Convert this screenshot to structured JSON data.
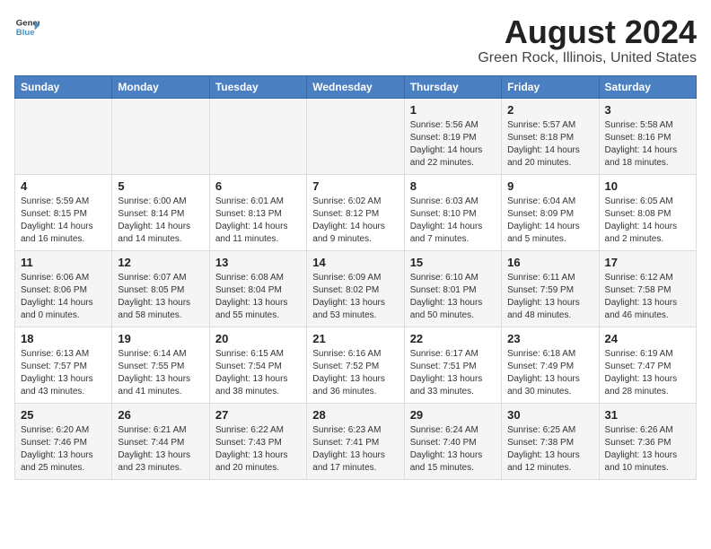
{
  "header": {
    "logo_line1": "General",
    "logo_line2": "Blue",
    "title": "August 2024",
    "subtitle": "Green Rock, Illinois, United States"
  },
  "weekdays": [
    "Sunday",
    "Monday",
    "Tuesday",
    "Wednesday",
    "Thursday",
    "Friday",
    "Saturday"
  ],
  "weeks": [
    [
      {
        "day": "",
        "info": ""
      },
      {
        "day": "",
        "info": ""
      },
      {
        "day": "",
        "info": ""
      },
      {
        "day": "",
        "info": ""
      },
      {
        "day": "1",
        "info": "Sunrise: 5:56 AM\nSunset: 8:19 PM\nDaylight: 14 hours\nand 22 minutes."
      },
      {
        "day": "2",
        "info": "Sunrise: 5:57 AM\nSunset: 8:18 PM\nDaylight: 14 hours\nand 20 minutes."
      },
      {
        "day": "3",
        "info": "Sunrise: 5:58 AM\nSunset: 8:16 PM\nDaylight: 14 hours\nand 18 minutes."
      }
    ],
    [
      {
        "day": "4",
        "info": "Sunrise: 5:59 AM\nSunset: 8:15 PM\nDaylight: 14 hours\nand 16 minutes."
      },
      {
        "day": "5",
        "info": "Sunrise: 6:00 AM\nSunset: 8:14 PM\nDaylight: 14 hours\nand 14 minutes."
      },
      {
        "day": "6",
        "info": "Sunrise: 6:01 AM\nSunset: 8:13 PM\nDaylight: 14 hours\nand 11 minutes."
      },
      {
        "day": "7",
        "info": "Sunrise: 6:02 AM\nSunset: 8:12 PM\nDaylight: 14 hours\nand 9 minutes."
      },
      {
        "day": "8",
        "info": "Sunrise: 6:03 AM\nSunset: 8:10 PM\nDaylight: 14 hours\nand 7 minutes."
      },
      {
        "day": "9",
        "info": "Sunrise: 6:04 AM\nSunset: 8:09 PM\nDaylight: 14 hours\nand 5 minutes."
      },
      {
        "day": "10",
        "info": "Sunrise: 6:05 AM\nSunset: 8:08 PM\nDaylight: 14 hours\nand 2 minutes."
      }
    ],
    [
      {
        "day": "11",
        "info": "Sunrise: 6:06 AM\nSunset: 8:06 PM\nDaylight: 14 hours\nand 0 minutes."
      },
      {
        "day": "12",
        "info": "Sunrise: 6:07 AM\nSunset: 8:05 PM\nDaylight: 13 hours\nand 58 minutes."
      },
      {
        "day": "13",
        "info": "Sunrise: 6:08 AM\nSunset: 8:04 PM\nDaylight: 13 hours\nand 55 minutes."
      },
      {
        "day": "14",
        "info": "Sunrise: 6:09 AM\nSunset: 8:02 PM\nDaylight: 13 hours\nand 53 minutes."
      },
      {
        "day": "15",
        "info": "Sunrise: 6:10 AM\nSunset: 8:01 PM\nDaylight: 13 hours\nand 50 minutes."
      },
      {
        "day": "16",
        "info": "Sunrise: 6:11 AM\nSunset: 7:59 PM\nDaylight: 13 hours\nand 48 minutes."
      },
      {
        "day": "17",
        "info": "Sunrise: 6:12 AM\nSunset: 7:58 PM\nDaylight: 13 hours\nand 46 minutes."
      }
    ],
    [
      {
        "day": "18",
        "info": "Sunrise: 6:13 AM\nSunset: 7:57 PM\nDaylight: 13 hours\nand 43 minutes."
      },
      {
        "day": "19",
        "info": "Sunrise: 6:14 AM\nSunset: 7:55 PM\nDaylight: 13 hours\nand 41 minutes."
      },
      {
        "day": "20",
        "info": "Sunrise: 6:15 AM\nSunset: 7:54 PM\nDaylight: 13 hours\nand 38 minutes."
      },
      {
        "day": "21",
        "info": "Sunrise: 6:16 AM\nSunset: 7:52 PM\nDaylight: 13 hours\nand 36 minutes."
      },
      {
        "day": "22",
        "info": "Sunrise: 6:17 AM\nSunset: 7:51 PM\nDaylight: 13 hours\nand 33 minutes."
      },
      {
        "day": "23",
        "info": "Sunrise: 6:18 AM\nSunset: 7:49 PM\nDaylight: 13 hours\nand 30 minutes."
      },
      {
        "day": "24",
        "info": "Sunrise: 6:19 AM\nSunset: 7:47 PM\nDaylight: 13 hours\nand 28 minutes."
      }
    ],
    [
      {
        "day": "25",
        "info": "Sunrise: 6:20 AM\nSunset: 7:46 PM\nDaylight: 13 hours\nand 25 minutes."
      },
      {
        "day": "26",
        "info": "Sunrise: 6:21 AM\nSunset: 7:44 PM\nDaylight: 13 hours\nand 23 minutes."
      },
      {
        "day": "27",
        "info": "Sunrise: 6:22 AM\nSunset: 7:43 PM\nDaylight: 13 hours\nand 20 minutes."
      },
      {
        "day": "28",
        "info": "Sunrise: 6:23 AM\nSunset: 7:41 PM\nDaylight: 13 hours\nand 17 minutes."
      },
      {
        "day": "29",
        "info": "Sunrise: 6:24 AM\nSunset: 7:40 PM\nDaylight: 13 hours\nand 15 minutes."
      },
      {
        "day": "30",
        "info": "Sunrise: 6:25 AM\nSunset: 7:38 PM\nDaylight: 13 hours\nand 12 minutes."
      },
      {
        "day": "31",
        "info": "Sunrise: 6:26 AM\nSunset: 7:36 PM\nDaylight: 13 hours\nand 10 minutes."
      }
    ]
  ]
}
